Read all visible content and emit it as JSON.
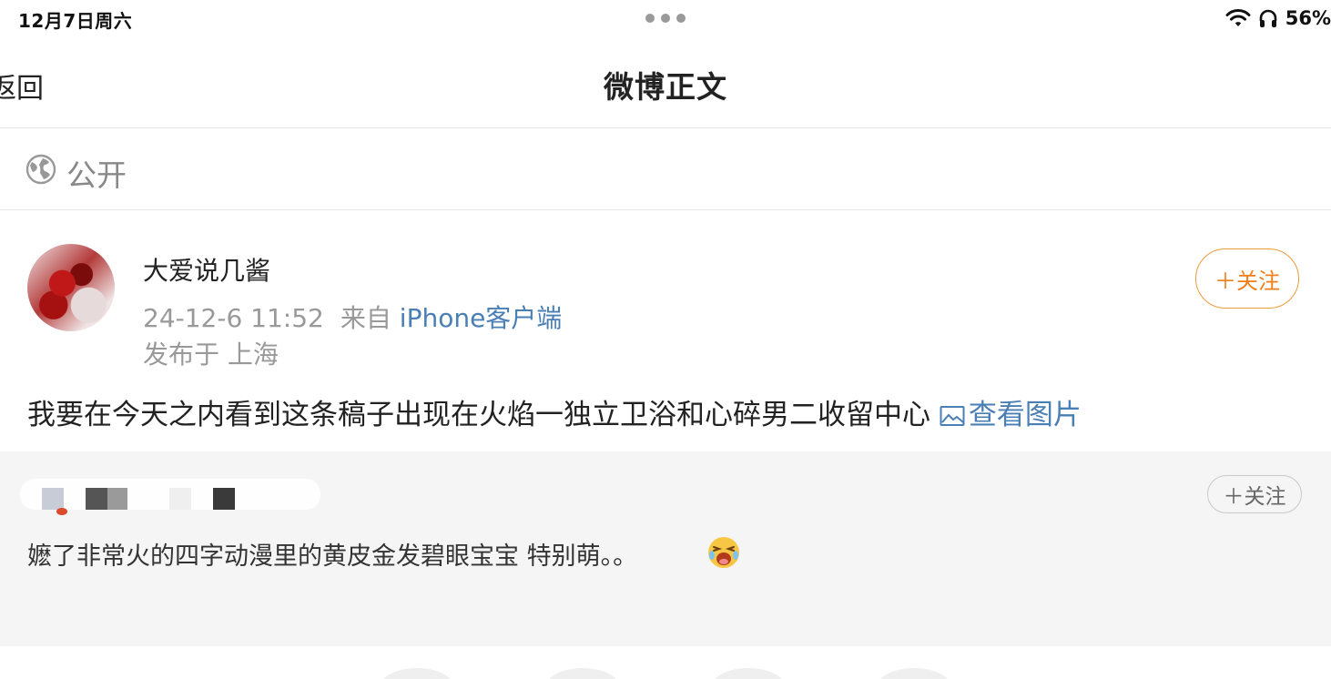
{
  "status_bar": {
    "date": "12月7日周六",
    "battery": "56%"
  },
  "nav": {
    "back_label": "返回",
    "title": "微博正文"
  },
  "visibility": {
    "label": "公开",
    "icon": "globe-icon"
  },
  "post": {
    "username": "大爱说几酱",
    "time": "24-12-6 11:52",
    "source_prefix": "来自",
    "client": "iPhone客户端",
    "location": "发布于 上海",
    "follow_label": "＋关注",
    "text": "我要在今天之内看到这条稿子出现在火焰一独立卫浴和心碎男二收留中心",
    "view_image_label": "查看图片"
  },
  "repost": {
    "follow_label": "＋关注",
    "text": "嬷了非常火的四字动漫里的黄皮金发碧眼宝宝 特别萌。。",
    "emoji": "laughing-crying-emoji"
  },
  "colors": {
    "link": "#4a7fb5",
    "follow_orange": "#f07f1a",
    "card_bg": "#f5f5f5"
  }
}
